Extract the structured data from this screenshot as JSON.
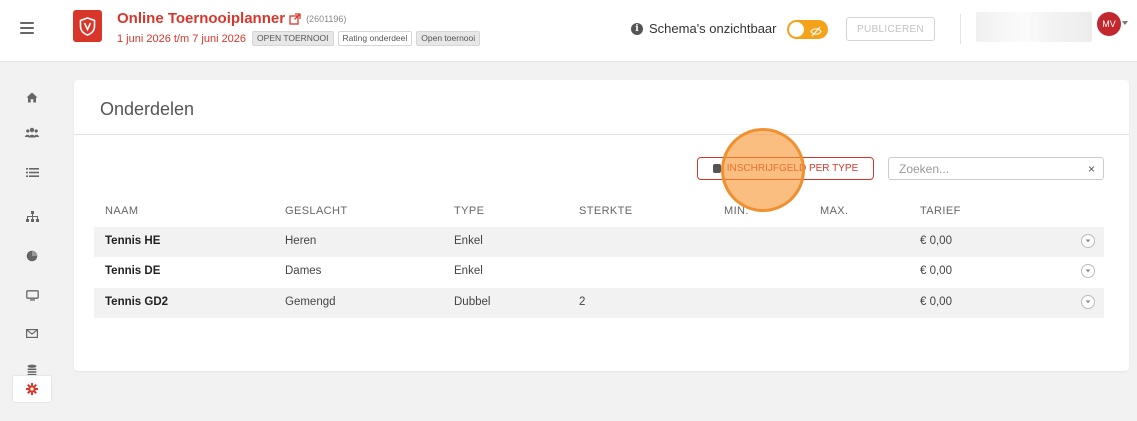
{
  "header": {
    "app_title": "Online Toernooiplanner",
    "app_id": "(2601196)",
    "date_range": "1 juni 2026 t/m 7 juni 2026",
    "badges": [
      "OPEN TOERNOOI",
      "Rating onderdeel",
      "Open toernooi"
    ],
    "schema_label": "Schema's onzichtbaar",
    "publish_label": "PUBLICEREN",
    "avatar_initials": "MV",
    "accent_color": "#d9362b",
    "toggle_color": "#f5a21b"
  },
  "sidebar": {
    "items": [
      {
        "icon": "home-icon"
      },
      {
        "icon": "users-icon"
      },
      {
        "icon": "list-icon"
      },
      {
        "icon": "hierarchy-icon"
      },
      {
        "icon": "pie-chart-icon"
      },
      {
        "icon": "monitor-icon"
      },
      {
        "icon": "mail-icon"
      },
      {
        "icon": "coins-icon"
      },
      {
        "icon": "gear-icon",
        "active": true
      }
    ]
  },
  "main": {
    "title": "Onderdelen",
    "type_button_label": "INSCHRIJFGELD PER TYPE",
    "search_placeholder": "Zoeken...",
    "search_clear": "×",
    "columns": [
      "NAAM",
      "GESLACHT",
      "TYPE",
      "STERKTE",
      "MIN.",
      "MAX.",
      "TARIEF"
    ],
    "rows": [
      {
        "naam": "Tennis HE",
        "geslacht": "Heren",
        "type": "Enkel",
        "sterkte": "",
        "min": "",
        "max": "",
        "tarief": "€ 0,00"
      },
      {
        "naam": "Tennis DE",
        "geslacht": "Dames",
        "type": "Enkel",
        "sterkte": "",
        "min": "",
        "max": "",
        "tarief": "€ 0,00"
      },
      {
        "naam": "Tennis GD2",
        "geslacht": "Gemengd",
        "type": "Dubbel",
        "sterkte": "2",
        "min": "",
        "max": "",
        "tarief": "€ 0,00"
      }
    ]
  }
}
